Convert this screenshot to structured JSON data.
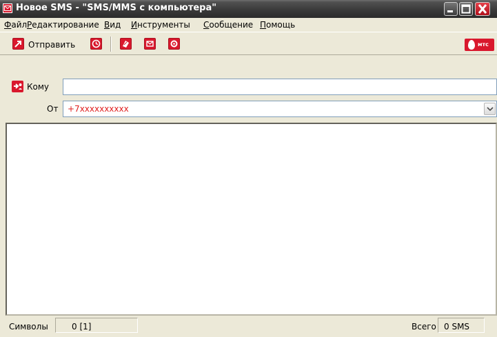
{
  "window": {
    "title": "Новое SMS - \"SMS/MMS с компьютера\""
  },
  "menu": {
    "items": [
      "Файл",
      "Редактирование",
      "Вид",
      "Инструменты",
      "Сообщение",
      "Помощь"
    ]
  },
  "toolbar": {
    "send_label": "Отправить",
    "brand_text": "мтс"
  },
  "address": {
    "to_label": "Кому",
    "to_value": "",
    "from_label": "От",
    "from_value": "+7xxxxxxxxxx"
  },
  "message": {
    "body": ""
  },
  "status": {
    "chars_label": "Символы",
    "chars_value": "0 [1]",
    "total_label": "Всего",
    "total_value": "0 SMS"
  },
  "colors": {
    "accent_red": "#d9182d",
    "from_text_red": "#e02020",
    "titlebar_dark": "#3a3a3a"
  }
}
